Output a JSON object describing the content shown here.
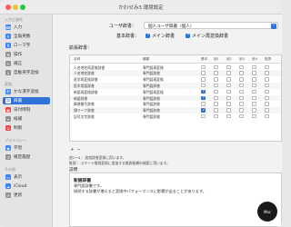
{
  "window": {
    "title": "かわせみ3 環境設定"
  },
  "sidebar": {
    "sections": [
      {
        "label": "入力と操作"
      },
      {
        "label": "変換"
      },
      {
        "label": "プライバシー"
      },
      {
        "label": "その他"
      }
    ],
    "items": [
      {
        "label": "入力",
        "icon": "keyboard-icon",
        "color": "#3b82f6"
      },
      {
        "label": "全角英数",
        "icon": "alphanumeric-icon",
        "color": "#3b82f6"
      },
      {
        "label": "ローマ字",
        "icon": "romaji-icon",
        "color": "#3b82f6"
      },
      {
        "label": "操作",
        "icon": "command-icon",
        "color": "#8e8e93"
      },
      {
        "label": "補正",
        "icon": "correction-icon",
        "color": "#8e8e93"
      },
      {
        "label": "自動英字変換",
        "icon": "auto-alpha-icon",
        "color": "#8e8e93"
      },
      {
        "label": "かな漢字変換",
        "icon": "kana-kanji-icon",
        "color": "#3b82f6"
      },
      {
        "label": "辞書",
        "icon": "dictionary-icon",
        "color": "#ffffff"
      },
      {
        "label": "日付時刻",
        "icon": "calendar-icon",
        "color": "#ef4444"
      },
      {
        "label": "候補",
        "icon": "candidates-icon",
        "color": "#8e8e93"
      },
      {
        "label": "制限",
        "icon": "restriction-icon",
        "color": "#ef4444"
      },
      {
        "label": "学習",
        "icon": "learning-icon",
        "color": "#3b82f6"
      },
      {
        "label": "確定履歴",
        "icon": "history-icon",
        "color": "#8e8e93"
      },
      {
        "label": "表示",
        "icon": "display-icon",
        "color": "#3b82f6"
      },
      {
        "label": "iCloud",
        "icon": "icloud-icon",
        "color": "#3b82f6"
      },
      {
        "label": "更新",
        "icon": "update-icon",
        "color": "#8e8e93"
      }
    ]
  },
  "main": {
    "user_dict_label": "ユーザ辞書：",
    "user_dict_value": "個人ユーザ辞書（個人）",
    "basic_dict_label": "基本辞書：",
    "main_dict_label": "メイン辞書",
    "main_convert_dict_label": "メイン再変換辞書",
    "extra_dict_label": "拡張辞書：",
    "columns": [
      "名称",
      "種類",
      "基本",
      "追1",
      "追2",
      "追3",
      "追4",
      "推測"
    ],
    "rows": [
      {
        "name": "人名地名再変換辞書",
        "type": "専門語再変換",
        "checks": [
          false,
          false,
          false,
          false,
          false,
          false
        ]
      },
      {
        "name": "人名地名辞書",
        "type": "専門語辞書",
        "checks": [
          false,
          false,
          false,
          false,
          false,
          false
        ]
      },
      {
        "name": "医学再変換辞書",
        "type": "専門語再変換",
        "checks": [
          false,
          false,
          false,
          false,
          false,
          false
        ]
      },
      {
        "name": "医学用語辞書",
        "type": "専門語辞書",
        "checks": [
          false,
          false,
          false,
          false,
          false,
          false
        ]
      },
      {
        "name": "新語再変換辞書",
        "type": "専門語再変換",
        "checks": [
          true,
          false,
          false,
          false,
          false,
          false
        ]
      },
      {
        "name": "新語辞書",
        "type": "専門語辞書",
        "checks": [
          true,
          false,
          false,
          false,
          false,
          false
        ]
      },
      {
        "name": "郵便番号辞書",
        "type": "専門語辞書",
        "checks": [
          false,
          false,
          false,
          false,
          false,
          false
        ]
      },
      {
        "name": "顔マーク辞書",
        "type": "専門語辞書",
        "checks": [
          true,
          false,
          false,
          false,
          false,
          false
        ]
      },
      {
        "name": "記号文字辞書",
        "type": "専門語辞書",
        "checks": [
          false,
          false,
          false,
          false,
          false,
          false
        ]
      }
    ],
    "add_label": "+",
    "remove_label": "−",
    "note_line_1": "追1〜4 ：追加辞書変換に用います。",
    "note_line_2": "推測 ：スマート推測変換に追加する推測候補の検索に用います。",
    "desc_section_label": "説明",
    "desc_title": "新語辞書",
    "desc_line_1": "専門語辞書です。",
    "desc_line_2": "接続する辞書が増えると変換中パフォーマンスに影響が出ることがあります。"
  },
  "watermark": {
    "text": "Mac 情報"
  }
}
